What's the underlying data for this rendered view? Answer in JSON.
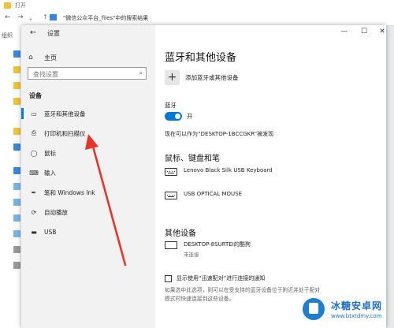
{
  "explorer": {
    "title": "打开",
    "breadcrumb": "\"微信公众平台_files\"中的搜索结果",
    "ribbon_tag": "组织"
  },
  "window": {
    "title": "设置",
    "back": "←",
    "minimize": "—",
    "maximize": "☐",
    "close": "✕"
  },
  "sidebar": {
    "home_label": "主页",
    "search_placeholder": "查找设置",
    "section": "设备",
    "items": [
      {
        "label": "蓝牙和其他设备",
        "icon": "▭"
      },
      {
        "label": "打印机和扫描仪",
        "icon": "⎙"
      },
      {
        "label": "鼠标",
        "icon": "◯"
      },
      {
        "label": "输入",
        "icon": "⌨"
      },
      {
        "label": "笔和 Windows Ink",
        "icon": "✒"
      },
      {
        "label": "自动播放",
        "icon": "⟳"
      },
      {
        "label": "USB",
        "icon": "▬"
      }
    ]
  },
  "main": {
    "title": "蓝牙和其他设备",
    "add_device": "添加蓝牙或其他设备",
    "bluetooth_label": "蓝牙",
    "bluetooth_state": "开",
    "discoverable": "现在可以作为“DESKTOP-1BCCGKR”被发现",
    "input_section": "鼠标、键盘和笔",
    "input_devices": [
      {
        "name": "Lenovo Black Silk USB Keyboard"
      },
      {
        "name": "USB OPTICAL MOUSE"
      }
    ],
    "other_section": "其他设备",
    "other_devices": [
      {
        "name": "DESKTOP-8SURTEI的酷狗",
        "status": "未连接"
      }
    ],
    "swift_pair_label": "显示使用“迅速配对”进行连接的通知",
    "hint_line1": "如果选中此选项，则可以在受支持的蓝牙设备位于附近并处于配对",
    "hint_line2": "模式时快速连接到这些设备。"
  },
  "watermark": {
    "site": "冰糖安卓网",
    "url": "www.btxtdmy.com"
  },
  "colors": {
    "accent": "#0078d7",
    "annotation": "#e8352b"
  }
}
